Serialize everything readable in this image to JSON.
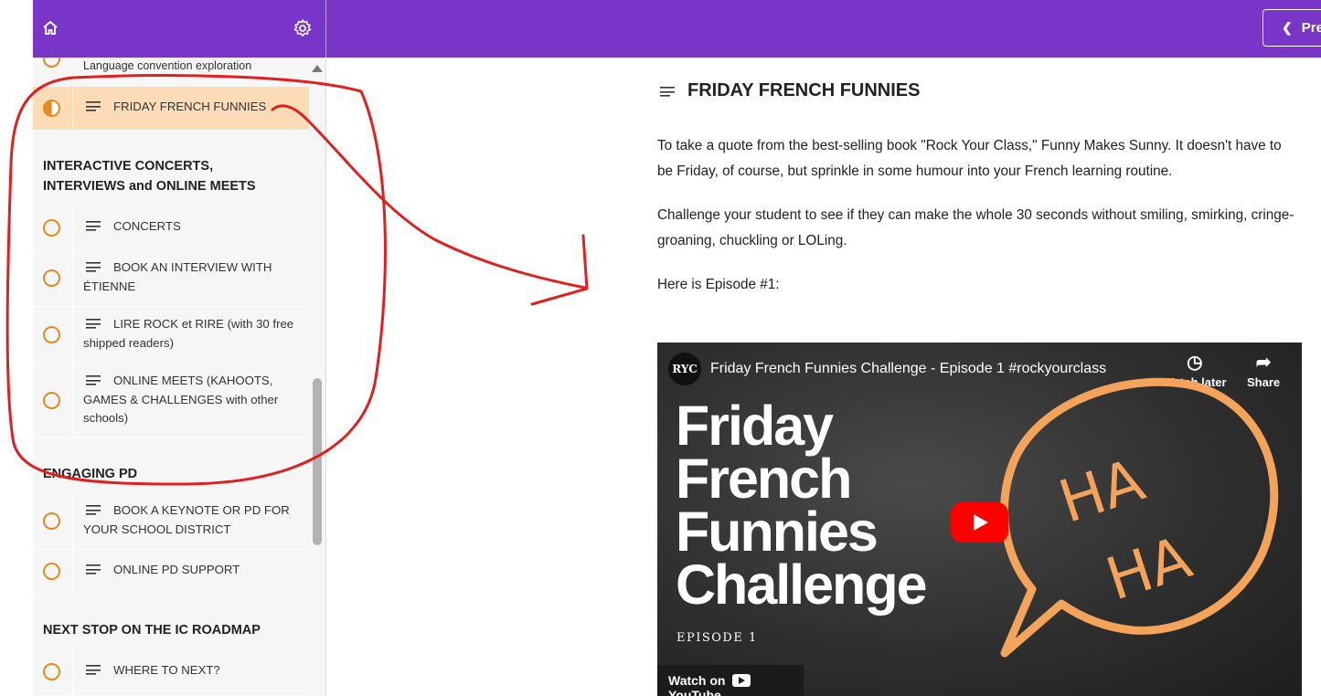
{
  "topbar": {
    "prev_label": "Pre"
  },
  "sidebar": {
    "lessons": [
      {
        "label": "Language convention exploration"
      },
      {
        "label": "FRIDAY FRENCH FUNNIES"
      },
      {
        "label": "CONCERTS"
      },
      {
        "label": "BOOK AN INTERVIEW WITH ÉTIENNE"
      },
      {
        "label": "LIRE ROCK et RIRE (with 30 free shipped readers)"
      },
      {
        "label": "ONLINE MEETS (KAHOOTS, GAMES & CHALLENGES with other schools)"
      },
      {
        "label": "BOOK A KEYNOTE OR PD FOR YOUR SCHOOL DISTRICT"
      },
      {
        "label": "ONLINE PD SUPPORT"
      },
      {
        "label": "WHERE TO NEXT?"
      }
    ],
    "sections": [
      {
        "title": "INTERACTIVE CONCERTS, INTERVIEWS and ONLINE MEETS"
      },
      {
        "title": "ENGAGING PD"
      },
      {
        "title": "NEXT STOP ON THE IC ROADMAP"
      }
    ]
  },
  "content": {
    "title": "FRIDAY FRENCH FUNNIES",
    "paragraphs": [
      "To take a quote from the best-selling book \"Rock Your Class,\" Funny Makes Sunny. It doesn't have to be Friday, of course, but sprinkle in some humour into your French learning routine.",
      "Challenge your student to see if they can make the whole 30 seconds without smiling, smirking, cringe-groaning, chuckling or LOLing.",
      "Here is Episode #1:"
    ]
  },
  "video": {
    "channel_logo": "RYC",
    "title": "Friday French Funnies Challenge - Episode 1 #rockyourclass",
    "watch_later": "Watch later",
    "share": "Share",
    "thumb_lines": [
      "Friday",
      "French",
      "Funnies",
      "Challenge"
    ],
    "episode": "EPISODE 1",
    "watch_on": "Watch on",
    "youtube": "YouTube",
    "bubble_text": [
      "HA",
      "HA"
    ]
  },
  "colors": {
    "topbar": "#7935c8",
    "accent": "#e58a1f",
    "active_row": "#fbdcb6",
    "annotation": "#e02020"
  }
}
